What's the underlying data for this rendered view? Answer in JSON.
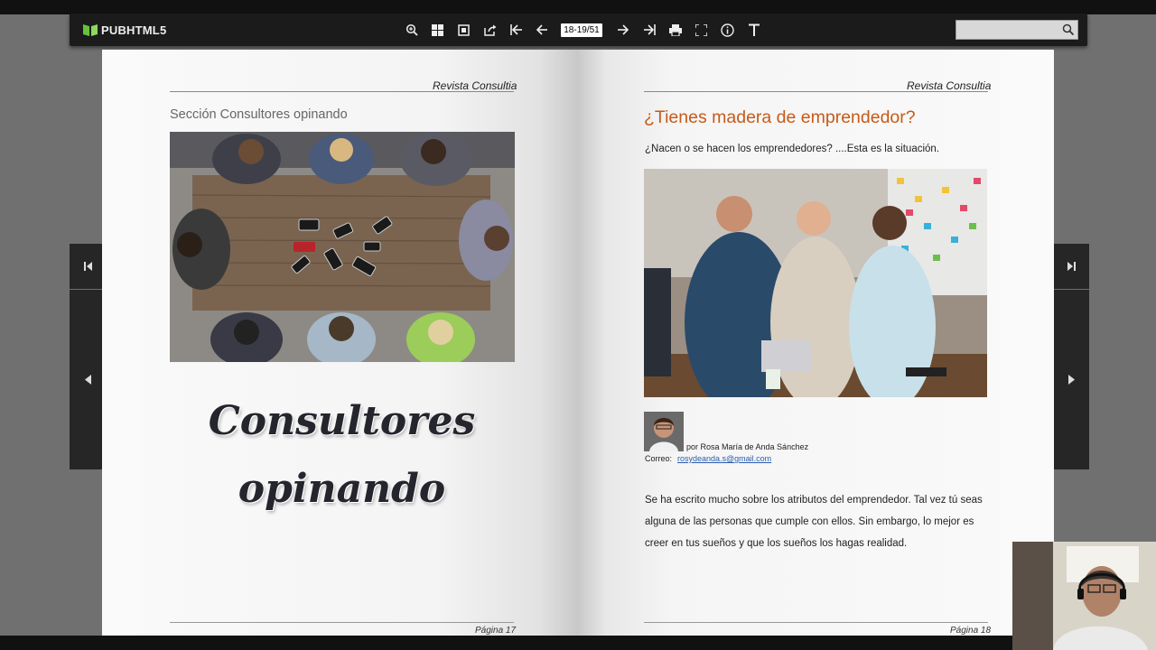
{
  "toolbar": {
    "logo_text": "PUBHTML5",
    "page_indicator": "18-19/51",
    "search": {
      "placeholder": "",
      "value": ""
    },
    "tools": [
      "zoom-in-icon",
      "thumbnails-icon",
      "single-page-icon",
      "share-icon",
      "first-page-icon",
      "previous-page-icon",
      "next-page-icon",
      "last-page-icon",
      "print-icon",
      "fullscreen-icon",
      "info-icon",
      "text-icon"
    ]
  },
  "left_page": {
    "header": "Revista Consultia",
    "section_title": "Sección Consultores opinando",
    "big_title_line1": "Consultores",
    "big_title_line2": "opinando",
    "footer": "Página 17"
  },
  "right_page": {
    "header": "Revista Consultia",
    "title": "¿Tienes madera de emprendedor?",
    "subtitle": "¿Nacen o se hacen los emprendedores? ....Esta es la situación.",
    "byline": "por Rosa María de Anda Sánchez",
    "email_label": "Correo:",
    "email": "rosydeanda.s@gmail.com",
    "body": "Se ha escrito mucho sobre los atributos del emprendedor. Tal vez tú seas alguna de las personas que cumple con ellos. Sin embargo, lo mejor es creer en tus sueños y que los sueños los hagas realidad.",
    "footer": "Página 18"
  },
  "colors": {
    "accent_title": "#c65a18",
    "toolbar_bg": "#1b1b1b",
    "link": "#2a5db0"
  }
}
